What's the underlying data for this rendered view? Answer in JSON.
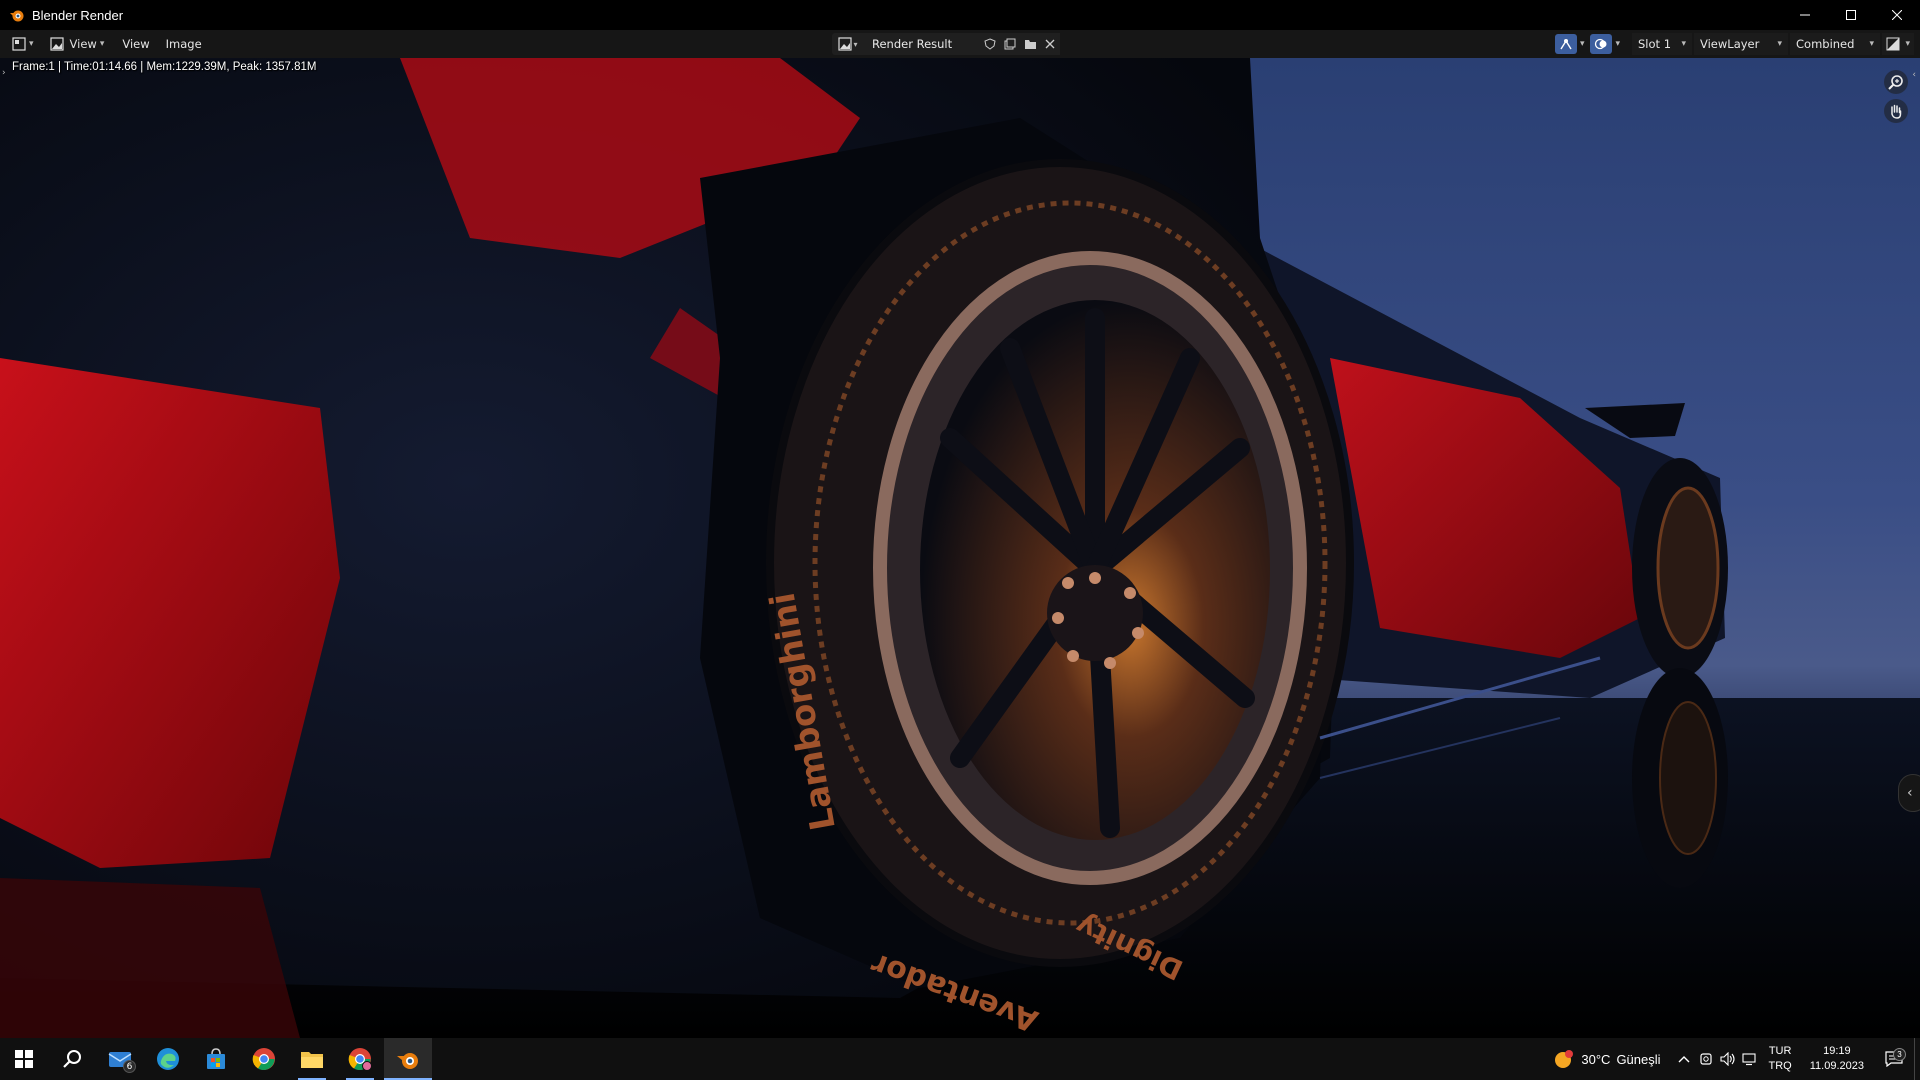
{
  "window": {
    "title": "Blender Render",
    "controls": [
      "minimize-icon",
      "maximize-icon",
      "close-icon"
    ]
  },
  "header": {
    "editor_type_icon": "image-editor-icon",
    "view_mode_label": "View",
    "menus": [
      "View",
      "Image"
    ],
    "image_name": "Render Result",
    "slot": "Slot 1",
    "view_layer": "ViewLayer",
    "pass": "Combined"
  },
  "viewport": {
    "stats": "Frame:1 | Time:01:14.66 | Mem:1229.39M, Peak: 1357.81M",
    "tire_text_upper": "Lamborghini",
    "tire_text_lower_left": "Aventador",
    "tire_text_lower_right": "Dignity"
  },
  "taskbar": {
    "apps": [
      {
        "name": "start",
        "icon": "windows-icon"
      },
      {
        "name": "search",
        "icon": "search-icon"
      },
      {
        "name": "mail",
        "icon": "mail-icon",
        "badge": "6"
      },
      {
        "name": "edge",
        "icon": "edge-icon"
      },
      {
        "name": "store",
        "icon": "store-icon"
      },
      {
        "name": "chrome",
        "icon": "chrome-icon"
      },
      {
        "name": "explorer",
        "icon": "folder-icon"
      },
      {
        "name": "chrome-profile",
        "icon": "chrome-icon"
      },
      {
        "name": "blender",
        "icon": "blender-icon"
      }
    ],
    "weather_temp": "30°C",
    "weather_desc": "Güneşli",
    "lang_top": "TUR",
    "lang_bottom": "TRQ",
    "time": "19:19",
    "date": "11.09.2023",
    "notification_count": "3"
  }
}
